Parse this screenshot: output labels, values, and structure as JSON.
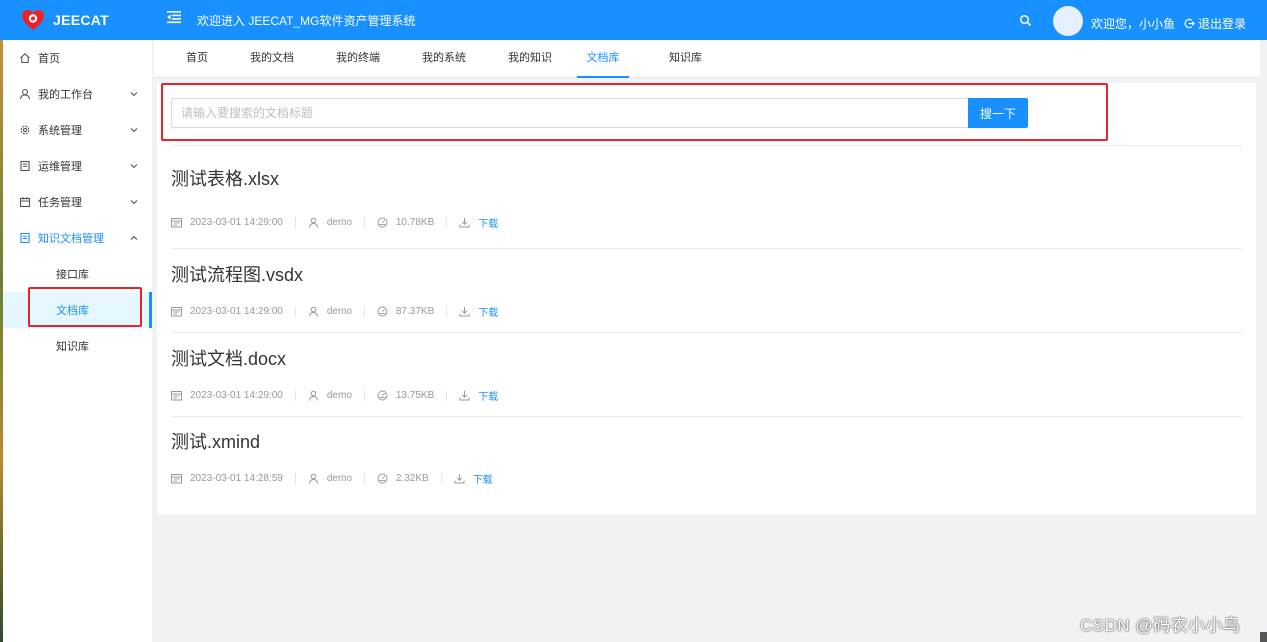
{
  "brand": {
    "name": "JEECAT",
    "color": "#1890ff"
  },
  "header": {
    "welcome": "欢迎进入 JEECAT_MG软件资产管理系统",
    "greeting": "欢迎您，小小鱼",
    "logout_label": "退出登录"
  },
  "sidebar": {
    "items": [
      {
        "label": "首页",
        "icon": "home-icon"
      },
      {
        "label": "我的工作台",
        "icon": "user-icon"
      },
      {
        "label": "系统管理",
        "icon": "gear-icon"
      },
      {
        "label": "运维管理",
        "icon": "book-icon"
      },
      {
        "label": "任务管理",
        "icon": "calendar-icon"
      },
      {
        "label": "知识文档管理",
        "icon": "document-icon"
      }
    ],
    "sub_items": [
      {
        "label": "接口库"
      },
      {
        "label": "文档库"
      },
      {
        "label": "知识库"
      }
    ]
  },
  "tabs": [
    {
      "label": "首页"
    },
    {
      "label": "我的文档"
    },
    {
      "label": "我的终端"
    },
    {
      "label": "我的系统"
    },
    {
      "label": "我的知识"
    },
    {
      "label": "文档库"
    },
    {
      "label": "知识库"
    }
  ],
  "search": {
    "placeholder": "请输入要搜索的文档标题",
    "value": "",
    "button_label": "搜一下"
  },
  "documents": [
    {
      "title": "测试表格.xlsx",
      "date": "2023-03-01 14:29:00",
      "author": "demo",
      "size": "10.78KB",
      "download_label": "下载"
    },
    {
      "title": "测试流程图.vsdx",
      "date": "2023-03-01 14:29:00",
      "author": "demo",
      "size": "87.37KB",
      "download_label": "下载"
    },
    {
      "title": "测试文档.docx",
      "date": "2023-03-01 14:29:00",
      "author": "demo",
      "size": "13.75KB",
      "download_label": "下载"
    },
    {
      "title": "测试.xmind",
      "date": "2023-03-01 14:28:59",
      "author": "demo",
      "size": "2.32KB",
      "download_label": "下载"
    }
  ],
  "watermark": "CSDN @码农小小鸟"
}
